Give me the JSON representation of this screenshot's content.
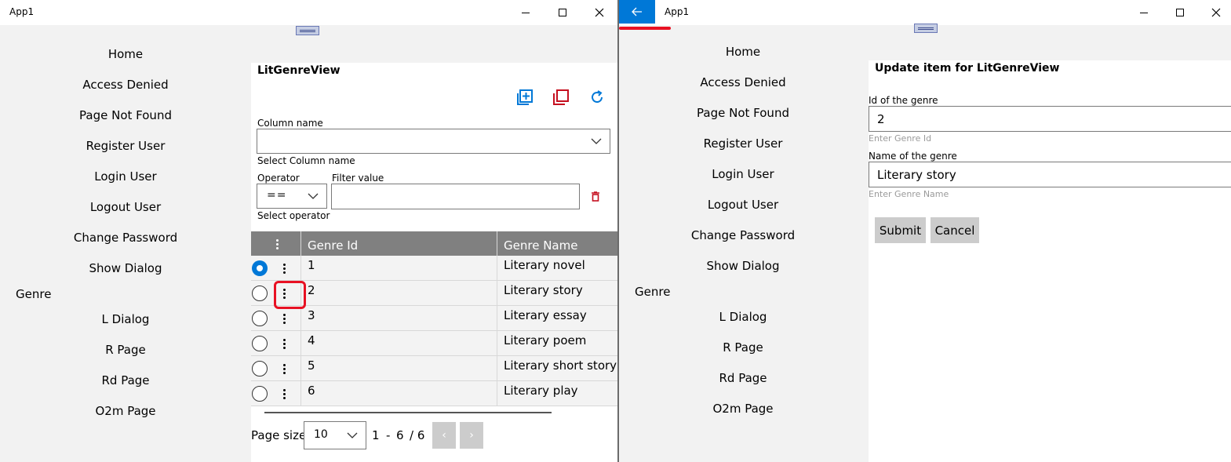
{
  "left_window": {
    "title": "App1",
    "nav": {
      "items": [
        "Home",
        "Access Denied",
        "Page Not Found",
        "Register User",
        "Login User",
        "Logout User",
        "Change Password",
        "Show Dialog"
      ],
      "group_label": "Genre",
      "group_items": [
        "L Dialog",
        "R Page",
        "Rd Page",
        "O2m Page"
      ]
    },
    "panel": {
      "title": "LitGenreView",
      "column_name_label": "Column name",
      "column_name_value": "",
      "column_name_hint": "Select Column name",
      "operator_label": "Operator",
      "operator_value": "==",
      "operator_hint": "Select operator",
      "filter_label": "Filter value",
      "filter_value": ""
    },
    "grid": {
      "columns": [
        "Genre Id",
        "Genre Name"
      ],
      "rows": [
        {
          "id": "1",
          "name": "Literary novel",
          "selected": true
        },
        {
          "id": "2",
          "name": "Literary story",
          "selected": false
        },
        {
          "id": "3",
          "name": "Literary essay",
          "selected": false
        },
        {
          "id": "4",
          "name": "Literary poem",
          "selected": false
        },
        {
          "id": "5",
          "name": "Literary short story",
          "selected": false
        },
        {
          "id": "6",
          "name": "Literary play",
          "selected": false
        }
      ]
    },
    "pager": {
      "page_size_label": "Page size",
      "page_size_value": "10",
      "range_start": "1",
      "range_sep": "-",
      "range_end": "6",
      "total": "/ 6",
      "prev_icon": "‹",
      "next_icon": "›"
    },
    "colors": {
      "accent": "#0078d7",
      "delete": "#c50f1f",
      "highlight": "#e81123"
    }
  },
  "right_window": {
    "title": "App1",
    "nav": {
      "items": [
        "Home",
        "Access Denied",
        "Page Not Found",
        "Register User",
        "Login User",
        "Logout User",
        "Change Password",
        "Show Dialog"
      ],
      "group_label": "Genre",
      "group_items": [
        "L Dialog",
        "R Page",
        "Rd Page",
        "O2m Page"
      ]
    },
    "form": {
      "title": "Update item for LitGenreView",
      "id_label": "Id of the genre",
      "id_value": "2",
      "id_hint": "Enter Genre Id",
      "name_label": "Name of the genre",
      "name_value": "Literary story",
      "name_hint": "Enter Genre Name",
      "submit_label": "Submit",
      "cancel_label": "Cancel"
    }
  }
}
